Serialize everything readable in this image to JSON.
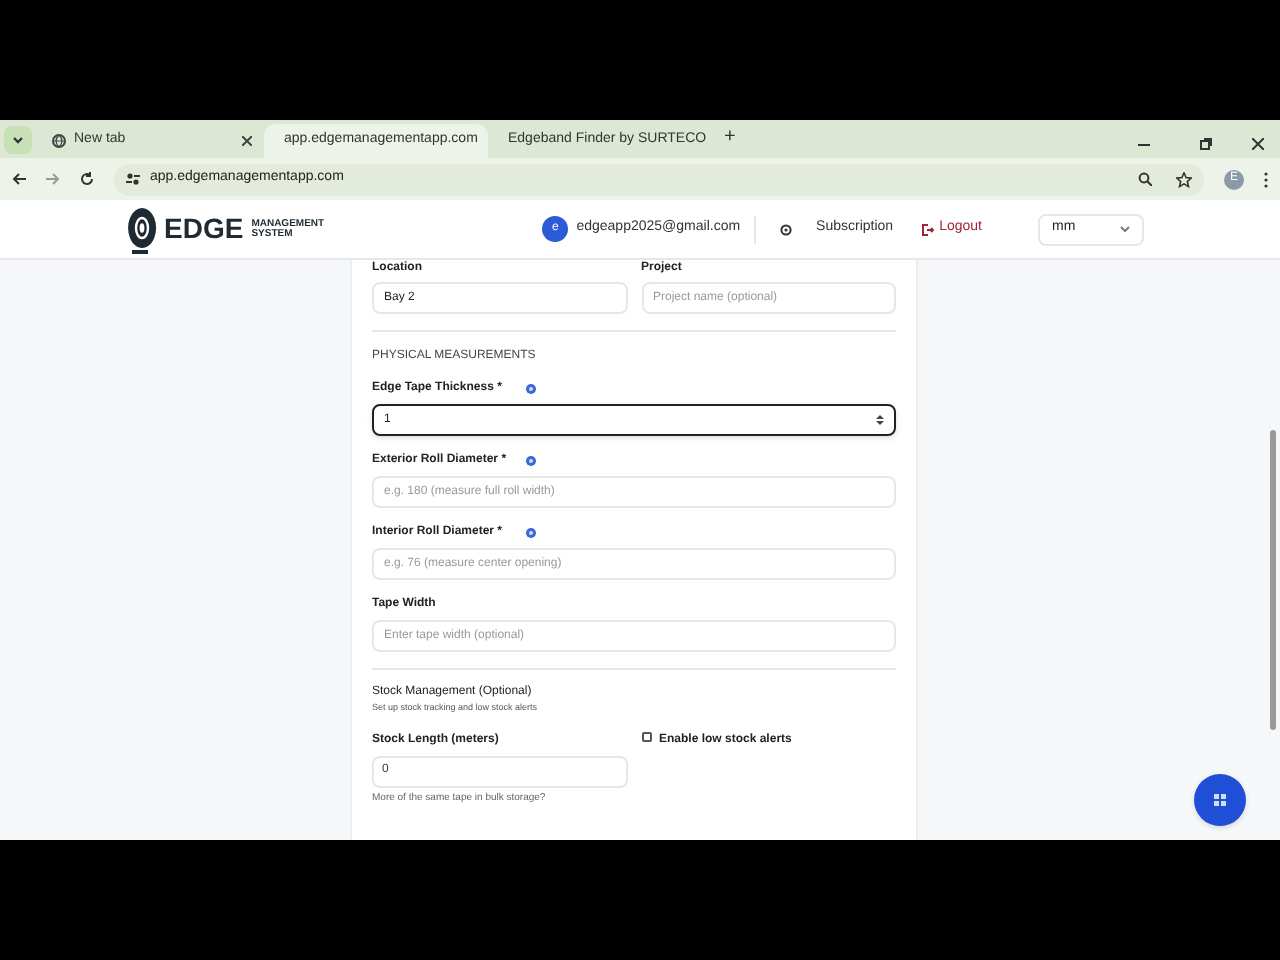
{
  "browser": {
    "tabs": [
      {
        "title": "New tab",
        "selected": false,
        "kind": "globe"
      },
      {
        "title": "app.edgemanagementapp.com",
        "selected": true,
        "kind": "globe"
      },
      {
        "title": "Edgeband Finder by SURTECO",
        "selected": false,
        "kind": "site"
      }
    ],
    "new_tab": "+",
    "address": "app.edgemanagementapp.com",
    "profile": "E"
  },
  "header": {
    "logo": "EDGE",
    "logo_sub": "MANAGEMENT SYSTEM",
    "avatar": "e",
    "email": "edgeapp2025@gmail.com",
    "subscription": "Subscription",
    "logout": "Logout",
    "unit": "mm"
  },
  "form": {
    "top_fields": [
      {
        "label": "Location",
        "value": "Bay 2"
      },
      {
        "label": "Project",
        "placeholder": "Project name (optional)"
      }
    ],
    "section_title": "PHYSICAL MEASUREMENTS",
    "fields": [
      {
        "label": "Edge Tape Thickness *",
        "info": true,
        "focused": true,
        "value": "1"
      },
      {
        "label": "Exterior Roll Diameter *",
        "info": true,
        "focused": false,
        "placeholder": "e.g. 180 (measure full roll width)"
      },
      {
        "label": "Interior Roll Diameter *",
        "info": true,
        "focused": false,
        "placeholder": "e.g. 76 (measure center opening)"
      },
      {
        "label": "Tape Width",
        "info": false,
        "focused": false,
        "placeholder": "Enter tape width (optional)"
      }
    ],
    "stock": {
      "title": "Stock Management (Optional)",
      "subtitle": "Set up stock tracking and low stock alerts",
      "length_label": "Stock Length (meters)",
      "length_value": "0",
      "hint": "More of the same tape in bulk storage?",
      "alert_label": "Enable low stock alerts",
      "alert_checked": false
    }
  }
}
